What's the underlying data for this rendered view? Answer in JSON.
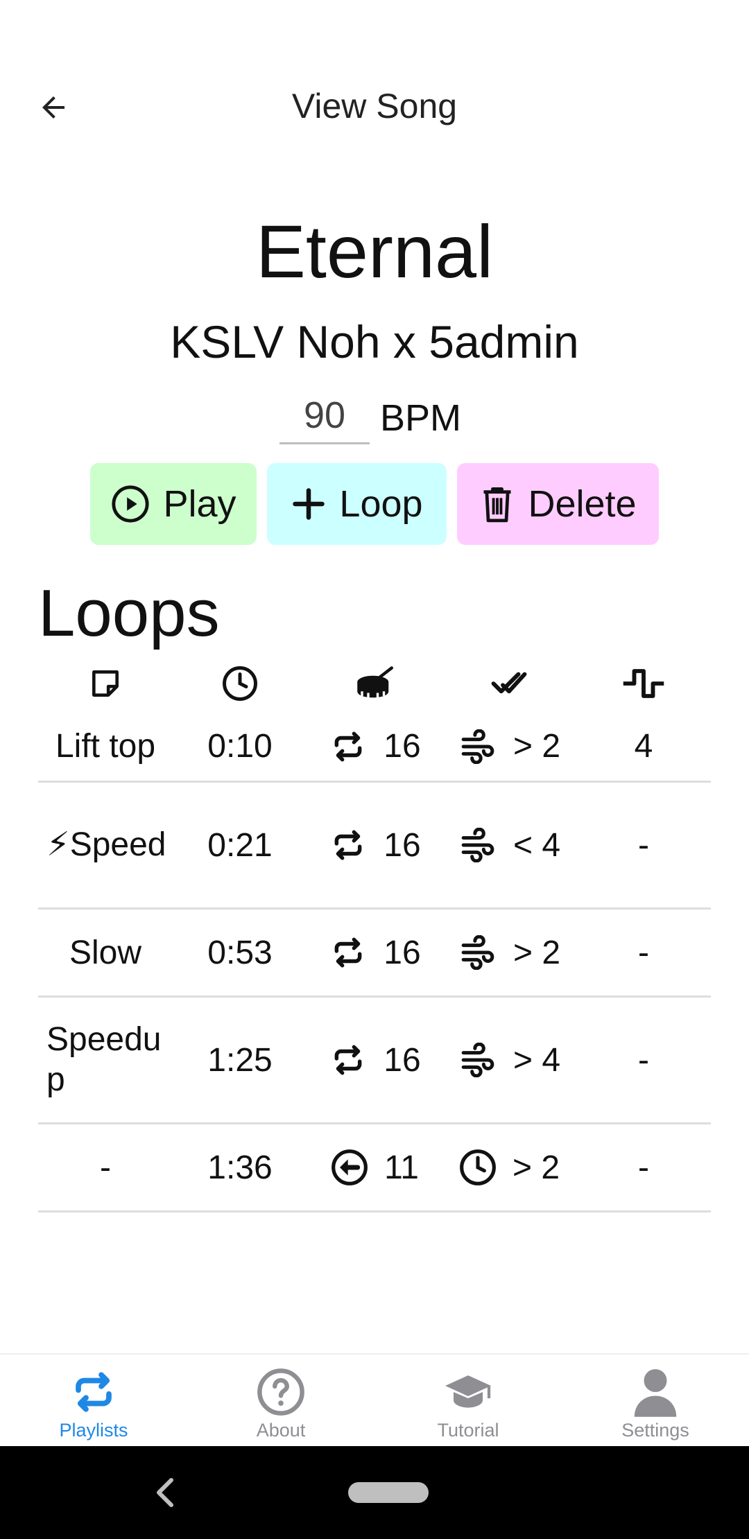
{
  "header": {
    "title": "View Song"
  },
  "song": {
    "title": "Eternal",
    "artist": "KSLV Noh x 5admin",
    "bpm": "90",
    "bpm_unit": "BPM"
  },
  "actions": {
    "play": "Play",
    "loop": "Loop",
    "delete": "Delete"
  },
  "loops": {
    "heading": "Loops",
    "columns": [
      "note-icon",
      "clock-icon",
      "drum-icon",
      "double-check-icon",
      "wave-square-icon"
    ],
    "rows": [
      {
        "name": "Lift top",
        "time": "0:10",
        "repeat_icon": "repeat-icon",
        "repeat": "16",
        "cond_icon": "wind-icon",
        "cond": "> 2",
        "extra": "4"
      },
      {
        "name": "⚡Speed",
        "time": "0:21",
        "repeat_icon": "repeat-icon",
        "repeat": "16",
        "cond_icon": "wind-icon",
        "cond": "< 4",
        "extra": "-"
      },
      {
        "name": "Slow",
        "time": "0:53",
        "repeat_icon": "repeat-icon",
        "repeat": "16",
        "cond_icon": "wind-icon",
        "cond": "> 2",
        "extra": "-"
      },
      {
        "name": "Speedup",
        "time": "1:25",
        "repeat_icon": "repeat-icon",
        "repeat": "16",
        "cond_icon": "wind-icon",
        "cond": "> 4",
        "extra": "-"
      },
      {
        "name": "-",
        "time": "1:36",
        "repeat_icon": "circle-arrow-left-icon",
        "repeat": "11",
        "cond_icon": "clock-icon",
        "cond": "> 2",
        "extra": "-"
      }
    ]
  },
  "tabs": [
    {
      "label": "Playlists",
      "icon": "repeat-icon",
      "active": true
    },
    {
      "label": "About",
      "icon": "question-circle-icon",
      "active": false
    },
    {
      "label": "Tutorial",
      "icon": "graduation-cap-icon",
      "active": false
    },
    {
      "label": "Settings",
      "icon": "user-icon",
      "active": false
    }
  ],
  "colors": {
    "play_bg": "#ccffcc",
    "loop_bg": "#ccffff",
    "delete_bg": "#ffccff",
    "accent": "#1e88e5",
    "inactive": "#8e8e93"
  }
}
